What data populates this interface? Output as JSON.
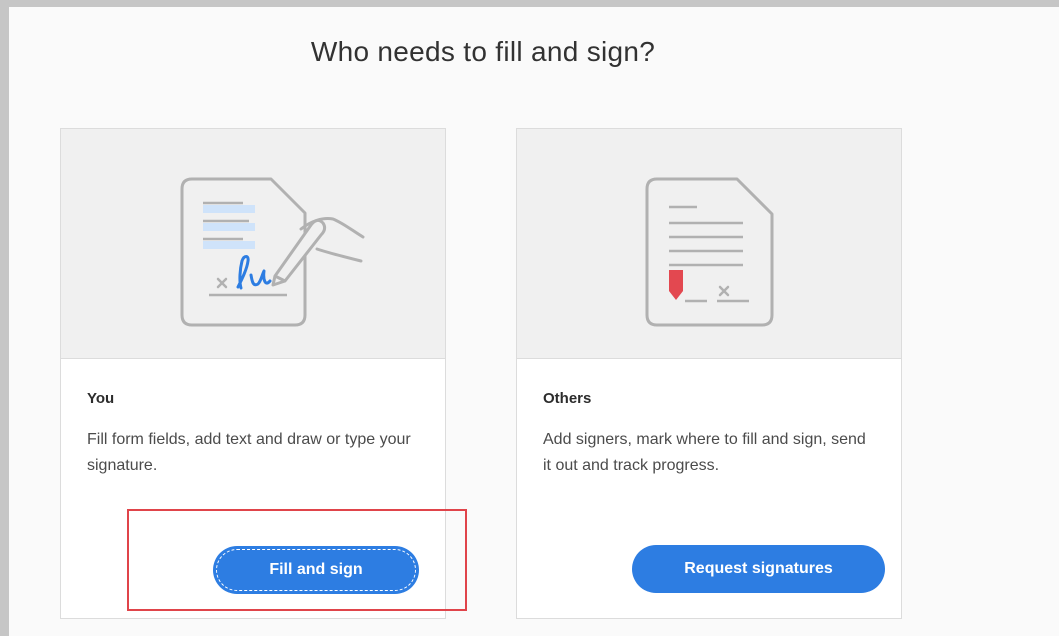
{
  "dialog": {
    "title": "Who needs to fill and sign?"
  },
  "options": [
    {
      "title": "You",
      "description": "Fill form fields, add text and draw or type your signature.",
      "button_label": "Fill and sign",
      "illustration": "document-pen-signature-icon"
    },
    {
      "title": "Others",
      "description": "Add signers, mark where to fill and sign, send it out and track progress.",
      "button_label": "Request signatures",
      "illustration": "document-signer-marker-icon"
    }
  ],
  "colors": {
    "button_blue": "#2d7de2",
    "signature_blue": "#2d7de2",
    "marker_red": "#e34850",
    "highlight_red": "#e0444a",
    "card_illustration_bg": "#f0f0f0"
  }
}
